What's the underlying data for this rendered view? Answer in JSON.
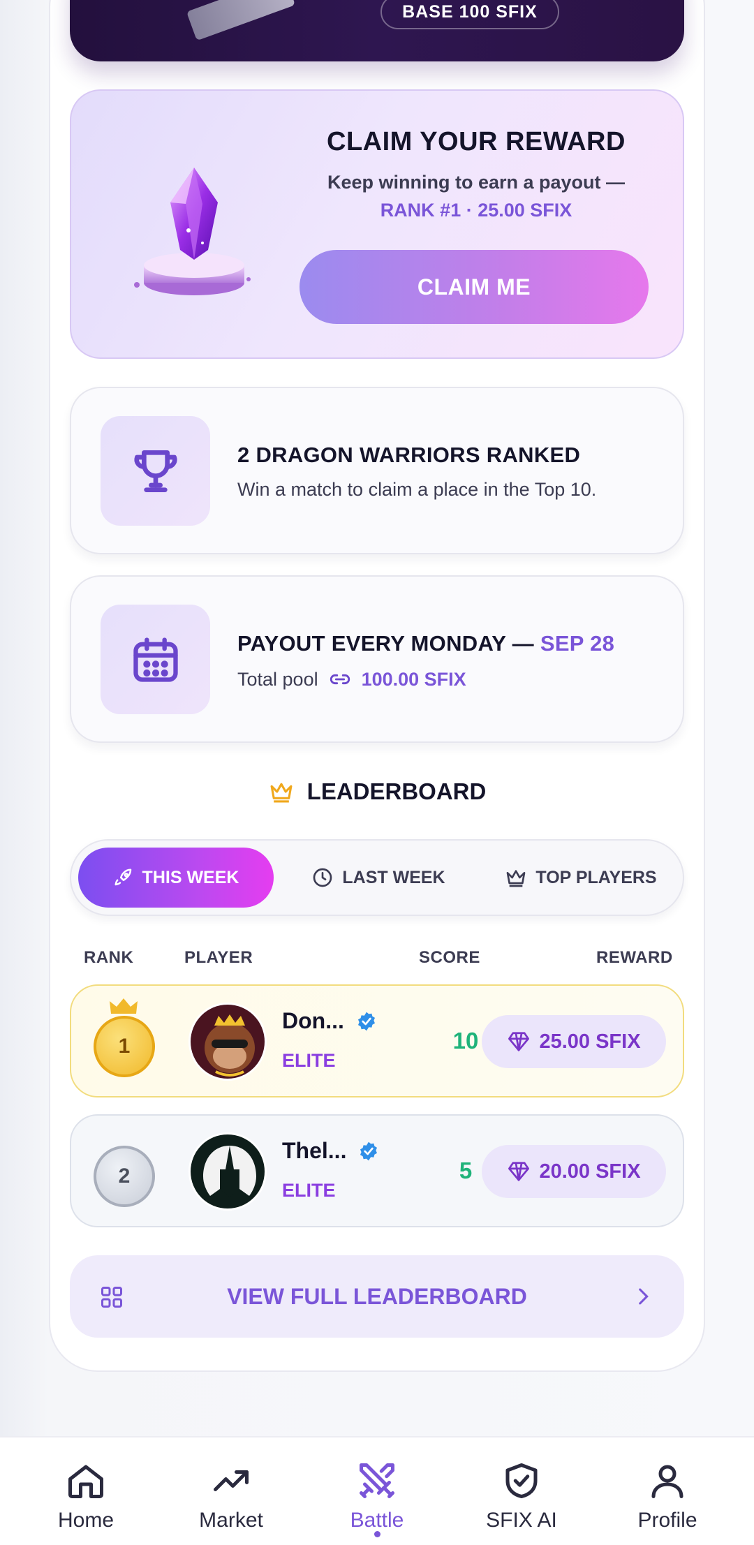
{
  "banner": {
    "base_label": "BASE 100 SFIX"
  },
  "claim": {
    "title": "CLAIM YOUR REWARD",
    "subtitle": "Keep winning to earn a payout —",
    "rank_line": "RANK #1 · 25.00 SFIX",
    "button_label": "CLAIM ME"
  },
  "ranked_card": {
    "icon": "trophy-icon",
    "title": "2 DRAGON WARRIORS RANKED",
    "subtitle": "Win a match to claim a place in the Top 10."
  },
  "payout_card": {
    "icon": "calendar-icon",
    "title_prefix": "PAYOUT EVERY MONDAY — ",
    "title_date": "SEP 28",
    "pool_label": "Total pool",
    "pool_icon": "link-icon",
    "pool_value": "100.00 SFIX"
  },
  "leaderboard": {
    "heading": "LEADERBOARD",
    "heading_icon": "crown-icon",
    "tabs": [
      {
        "label": "THIS WEEK",
        "icon": "rocket-icon",
        "active": true
      },
      {
        "label": "LAST WEEK",
        "icon": "clock-icon",
        "active": false
      },
      {
        "label": "TOP PLAYERS",
        "icon": "crown-icon",
        "active": false
      }
    ],
    "columns": {
      "rank": "RANK",
      "player": "PLAYER",
      "score": "SCORE",
      "reward": "REWARD"
    },
    "rows": [
      {
        "rank": "1",
        "name": "Don...",
        "tier": "ELITE",
        "score": "10",
        "reward": "25.00 SFIX",
        "verified": true
      },
      {
        "rank": "2",
        "name": "Thel...",
        "tier": "ELITE",
        "score": "5",
        "reward": "20.00 SFIX",
        "verified": true
      }
    ],
    "view_full_label": "VIEW FULL LEADERBOARD"
  },
  "nav": {
    "items": [
      {
        "label": "Home",
        "icon": "home-icon"
      },
      {
        "label": "Market",
        "icon": "trending-up-icon"
      },
      {
        "label": "Battle",
        "icon": "crossed-swords-icon",
        "active": true
      },
      {
        "label": "SFIX AI",
        "icon": "shield-check-icon"
      },
      {
        "label": "Profile",
        "icon": "user-icon"
      }
    ]
  },
  "colors": {
    "accent": "#7a55d8",
    "score_green": "#1fb37a",
    "tier_purple": "#8a3ee0",
    "gold": "#f1b92b"
  }
}
